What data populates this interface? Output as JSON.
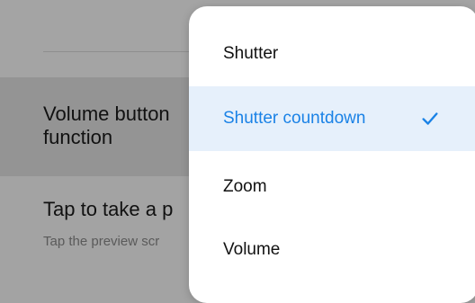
{
  "background": {
    "volume_title": "Volume button\nfunction",
    "tap_title": "Tap to take a p",
    "tap_subtitle": "Tap the preview scr"
  },
  "menu": {
    "options": [
      {
        "label": "Shutter",
        "selected": false
      },
      {
        "label": "Shutter countdown",
        "selected": true
      },
      {
        "label": "Zoom",
        "selected": false
      },
      {
        "label": "Volume",
        "selected": false
      }
    ],
    "accent_color": "#1a82e6",
    "selected_icon": "check-icon"
  }
}
